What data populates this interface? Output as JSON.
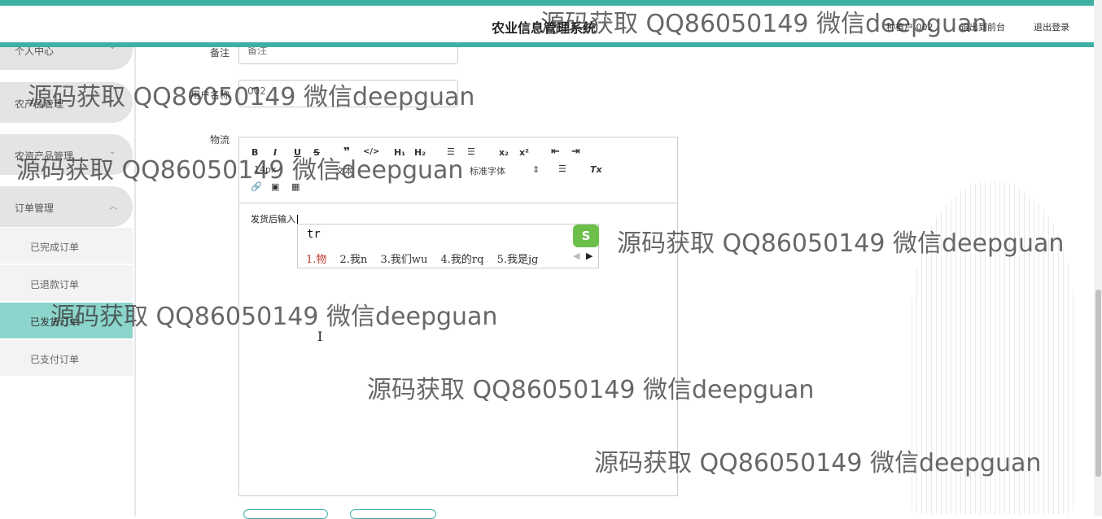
{
  "header": {
    "title": "农业信息管理系统",
    "user": "种植户 002",
    "to_front": "退出到前台",
    "logout": "退出登录"
  },
  "sidebar": {
    "menus": [
      {
        "label": "个人中心",
        "chev": "⌄"
      },
      {
        "label": "农产品管理",
        "chev": "⌄"
      },
      {
        "label": "农资产品管理",
        "chev": "⌄"
      },
      {
        "label": "订单管理",
        "chev": "︿"
      }
    ],
    "sub_items": [
      "已完成订单",
      "已退款订单",
      "已发货订单",
      "已支付订单"
    ],
    "active_sub": "已发货订单"
  },
  "form": {
    "remark_label": "备注",
    "remark_placeholder": "备注",
    "user_label": "用户名称",
    "user_value": "002",
    "logistics_label": "物流"
  },
  "editor": {
    "toolbar": {
      "bold": "B",
      "italic": "I",
      "underline": "U",
      "strike": "S",
      "quote": "❞",
      "code": "</>",
      "h1": "H₁",
      "h2": "H₂",
      "ol": "☰",
      "ul": "☰",
      "sub": "x₂",
      "sup": "x²",
      "outdent": "⇤",
      "indent": "⇥",
      "size": "14px",
      "text": "文本",
      "font": "标准字体",
      "align": "☰",
      "clear": "Tx",
      "link": "🔗",
      "image": "▣",
      "video": "▦"
    },
    "content": "发货后输入"
  },
  "ime": {
    "code": "tr",
    "candidates": [
      "1.物",
      "2.我n",
      "3.我们wu",
      "4.我的rq",
      "5.我是jg"
    ],
    "logo": "S"
  },
  "watermark": "源码获取 QQ86050149 微信deepguan"
}
